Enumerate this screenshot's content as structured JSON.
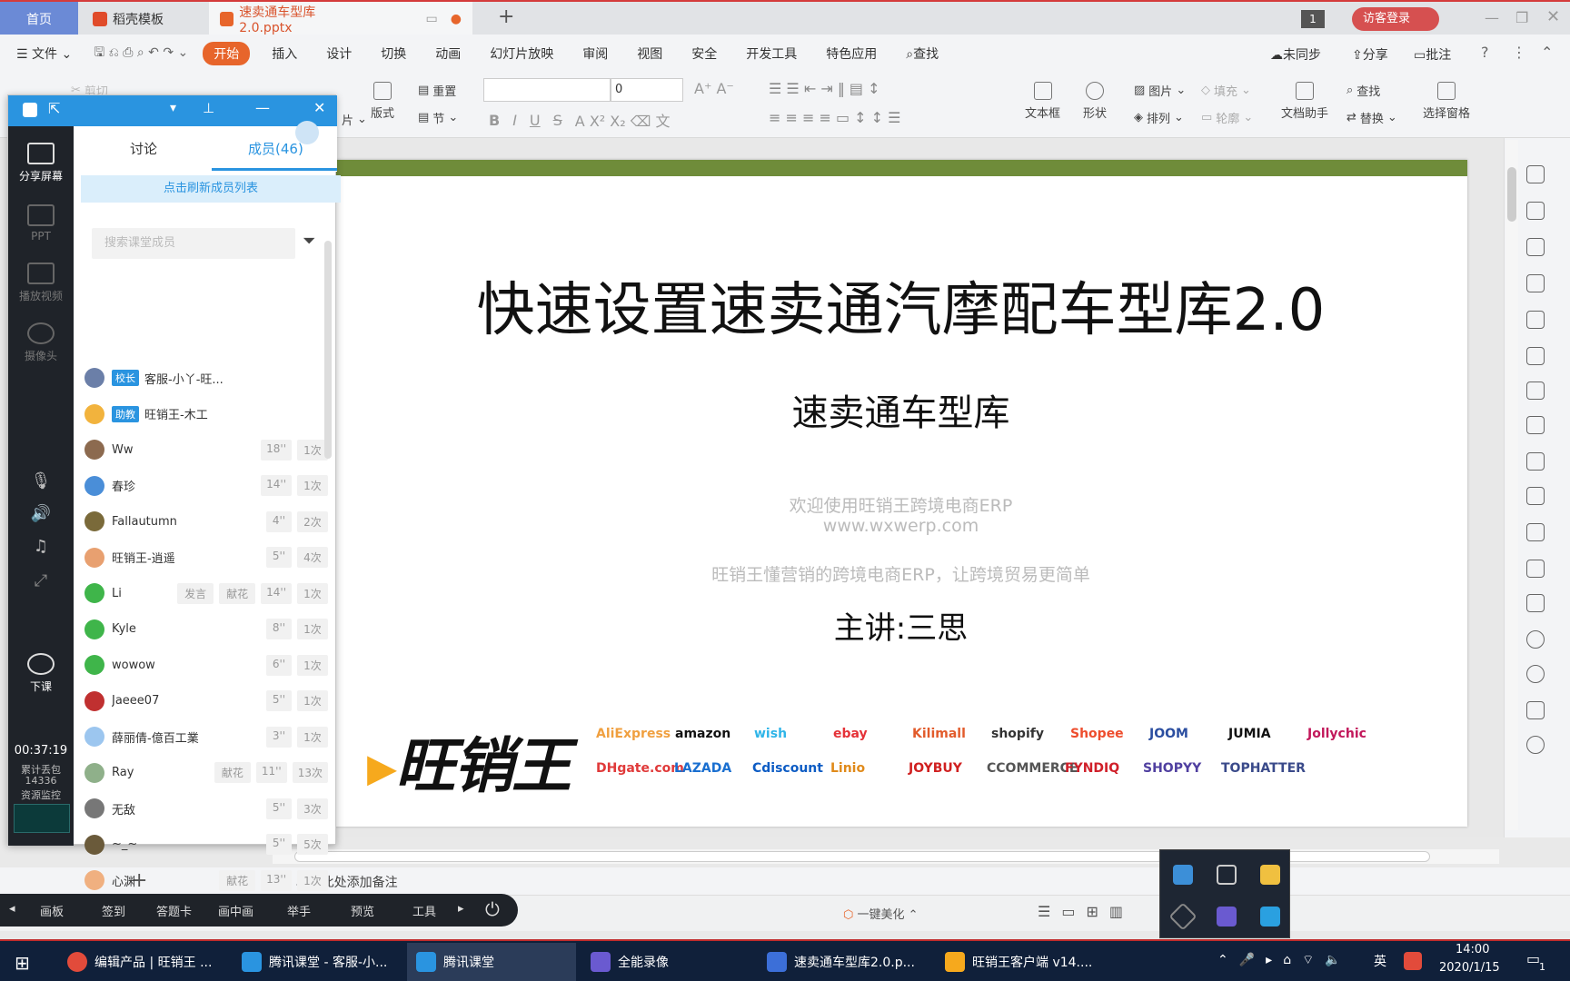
{
  "tabs": {
    "home": "首页",
    "template": "稻壳模板",
    "doc": "速卖通车型库2.0.pptx",
    "page_badge": "1",
    "login": "访客登录"
  },
  "menu": {
    "file": "文件",
    "items": [
      "开始",
      "插入",
      "设计",
      "切换",
      "动画",
      "幻灯片放映",
      "审阅",
      "视图",
      "安全",
      "开发工具",
      "特色应用"
    ],
    "search": "查找",
    "sync": "未同步",
    "share": "分享",
    "comment": "批注"
  },
  "ribbon": {
    "cut": "剪切",
    "layout": "版式",
    "reset": "重置",
    "section": "节",
    "font_size": "0",
    "textbox": "文本框",
    "shape": "形状",
    "picture": "图片",
    "fill": "填充",
    "arrange": "排列",
    "outline": "轮廓",
    "doc_helper": "文档助手",
    "find": "查找",
    "replace": "替换",
    "select_pane": "选择窗格",
    "slide_prefix": "片"
  },
  "slide": {
    "title": "快速设置速卖通汽摩配车型库2.0",
    "subtitle": "速卖通车型库",
    "line1": "欢迎使用旺销王跨境电商ERP",
    "line2": "www.wxwerp.com",
    "line3": "旺销王懂营销的跨境电商ERP，让跨境贸易更简单",
    "speaker": "主讲:三思",
    "logo": "旺销王",
    "platforms_row1": [
      "AliExpress",
      "amazon",
      "wish",
      "ebay",
      "Kilimall",
      "shopify",
      "Shopee",
      "JOOM",
      "JUMIA",
      "Jollychic"
    ],
    "platforms_row2": [
      "DHgate.com",
      "LAZADA",
      "Cdiscount",
      "Linio",
      "JOYBUY",
      "CCOMMERCE",
      "FYNDIQ",
      "SHOPYY",
      "TOPHATTER"
    ]
  },
  "notes": {
    "placeholder": "单击此处添加备注"
  },
  "status": {
    "beautify": "一键美化"
  },
  "classroom": {
    "side": {
      "share": "分享屏幕",
      "ppt": "PPT",
      "video": "播放视频",
      "camera": "摄像头",
      "end": "下课",
      "timer": "00:37:19",
      "loss_label": "累计丢包",
      "loss_value": "14336",
      "monitor": "资源监控"
    },
    "tab_discuss": "讨论",
    "tab_members": "成员(46)",
    "refresh": "点击刷新成员列表",
    "search_placeholder": "搜索课堂成员",
    "members": [
      {
        "name": "客服-小丫-旺...",
        "role": "校长",
        "hand": "",
        "flower": "",
        "time": "",
        "count": "",
        "color": "#6b7fa8"
      },
      {
        "name": "旺销王-木工",
        "role": "助教",
        "hand": "",
        "flower": "",
        "time": "",
        "count": "",
        "color": "#f2b33d"
      },
      {
        "name": "Ww",
        "role": "",
        "hand": "",
        "flower": "",
        "time": "18''",
        "count": "1次",
        "color": "#8c6a4f"
      },
      {
        "name": "春珍",
        "role": "",
        "hand": "",
        "flower": "",
        "time": "14''",
        "count": "1次",
        "color": "#4a8ed8"
      },
      {
        "name": "Fallautumn",
        "role": "",
        "hand": "",
        "flower": "",
        "time": "4''",
        "count": "2次",
        "color": "#7a6a3a"
      },
      {
        "name": "旺销王-逍遥",
        "role": "",
        "hand": "",
        "flower": "",
        "time": "5''",
        "count": "4次",
        "color": "#e8a070"
      },
      {
        "name": "Li",
        "role": "",
        "hand": "发言",
        "flower": "献花",
        "time": "14''",
        "count": "1次",
        "color": "#3fb54a"
      },
      {
        "name": "Kyle",
        "role": "",
        "hand": "",
        "flower": "",
        "time": "8''",
        "count": "1次",
        "color": "#3fb54a"
      },
      {
        "name": "wowow",
        "role": "",
        "hand": "",
        "flower": "",
        "time": "6''",
        "count": "1次",
        "color": "#3fb54a"
      },
      {
        "name": "Jaeee07",
        "role": "",
        "hand": "",
        "flower": "",
        "time": "5''",
        "count": "1次",
        "color": "#c03030"
      },
      {
        "name": "薛丽倩-億百工業",
        "role": "",
        "hand": "",
        "flower": "",
        "time": "3''",
        "count": "1次",
        "color": "#9cc6ef"
      },
      {
        "name": "Ray",
        "role": "",
        "hand": "",
        "flower": "献花",
        "time": "11''",
        "count": "13次",
        "color": "#8fb08a"
      },
      {
        "name": "无敌",
        "role": "",
        "hand": "",
        "flower": "",
        "time": "5''",
        "count": "3次",
        "color": "#777"
      },
      {
        "name": "~_~",
        "role": "",
        "hand": "",
        "flower": "",
        "time": "5''",
        "count": "5次",
        "color": "#6a5a3a"
      },
      {
        "name": "心渊",
        "role": "",
        "hand": "",
        "flower": "献花",
        "time": "13''",
        "count": "1次",
        "color": "#f0b080"
      }
    ],
    "toolbar": [
      "画板",
      "签到",
      "答题卡",
      "画中画",
      "举手",
      "预览",
      "工具"
    ]
  },
  "taskbar": {
    "items": [
      "编辑产品 | 旺销王 ...",
      "腾讯课堂 - 客服-小...",
      "腾讯课堂",
      "全能录像",
      "速卖通车型库2.0.p...",
      "旺销王客户端 v14...."
    ],
    "ime": "英",
    "time": "14:00",
    "date": "2020/1/15",
    "notif_count": "1"
  },
  "colors": {
    "accent": "#e7652b",
    "classroom_blue": "#2a94e0",
    "slide_bar": "#6f8c3a",
    "taskbar": "#10203a"
  }
}
